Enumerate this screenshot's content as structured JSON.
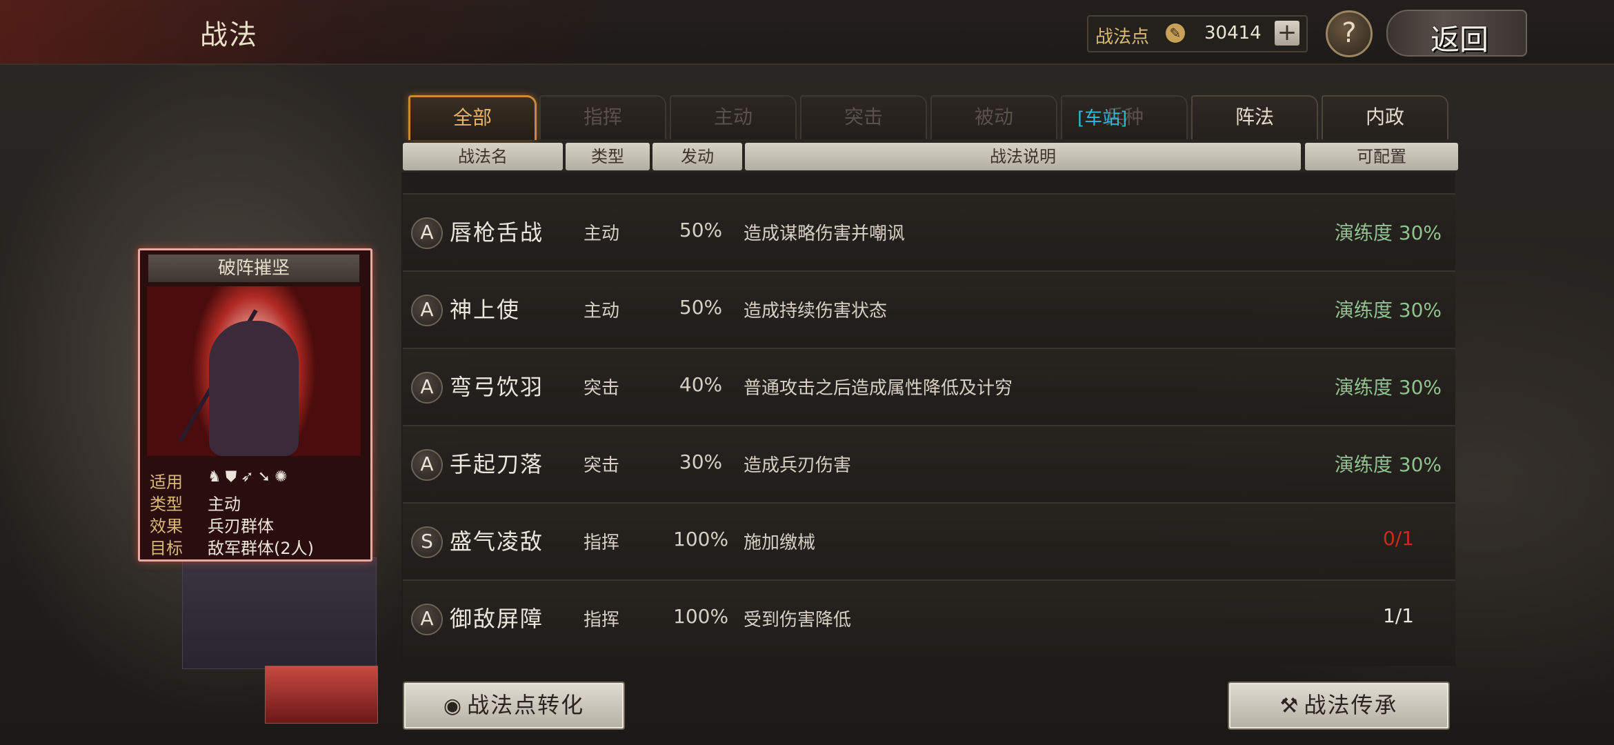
{
  "header": {
    "title": "战法",
    "points_label": "战法点",
    "points_value": "30414",
    "plus": "+",
    "help": "?",
    "back": "返回"
  },
  "tabs": [
    {
      "label": "全部",
      "state": "active"
    },
    {
      "label": "指挥",
      "state": "disabled"
    },
    {
      "label": "主动",
      "state": "disabled"
    },
    {
      "label": "突击",
      "state": "disabled"
    },
    {
      "label": "被动",
      "state": "disabled"
    },
    {
      "label": "兵种",
      "state": "disabled",
      "badge": "[车站]"
    },
    {
      "label": "阵法",
      "state": "enabled"
    },
    {
      "label": "内政",
      "state": "enabled"
    }
  ],
  "columns": [
    "战法名",
    "类型",
    "发动",
    "战法说明",
    "可配置"
  ],
  "skills": [
    {
      "grade": "A",
      "name": "唇枪舌战",
      "type": "主动",
      "rate": "50%",
      "desc": "造成谋略伤害并嘲讽",
      "config": "演练度 30%",
      "config_color": "#8fc28f"
    },
    {
      "grade": "A",
      "name": "神上使",
      "type": "主动",
      "rate": "50%",
      "desc": "造成持续伤害状态",
      "config": "演练度 30%",
      "config_color": "#8fc28f"
    },
    {
      "grade": "A",
      "name": "弯弓饮羽",
      "type": "突击",
      "rate": "40%",
      "desc": "普通攻击之后造成属性降低及计穷",
      "config": "演练度 30%",
      "config_color": "#8fc28f"
    },
    {
      "grade": "A",
      "name": "手起刀落",
      "type": "突击",
      "rate": "30%",
      "desc": "造成兵刃伤害",
      "config": "演练度 30%",
      "config_color": "#8fc28f"
    },
    {
      "grade": "S",
      "name": "盛气凌敌",
      "type": "指挥",
      "rate": "100%",
      "desc": "施加缴械",
      "config": "0/1",
      "config_color": "#cc2a1c"
    },
    {
      "grade": "A",
      "name": "御敌屏障",
      "type": "指挥",
      "rate": "100%",
      "desc": "受到伤害降低",
      "config": "1/1",
      "config_color": "#ece7dd"
    }
  ],
  "card": {
    "title": "破阵摧坚",
    "rows": [
      {
        "key": "适用",
        "value": "",
        "icons": [
          "cavalry-icon",
          "shield-icon",
          "bow-icon",
          "spear-icon",
          "chariot-icon"
        ]
      },
      {
        "key": "类型",
        "value": "主动"
      },
      {
        "key": "效果",
        "value": "兵刃群体"
      },
      {
        "key": "目标",
        "value": "敌军群体(2人)"
      }
    ]
  },
  "buttons": {
    "convert": "战法点转化",
    "inherit": "战法传承"
  }
}
